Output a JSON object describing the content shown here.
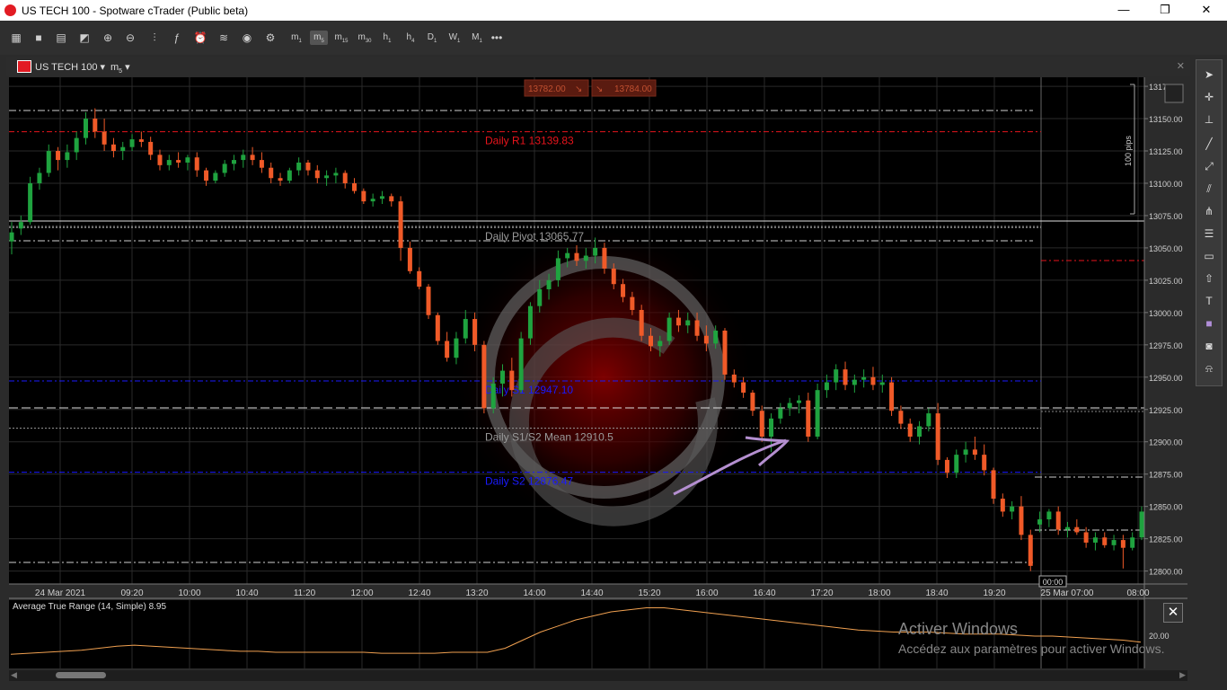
{
  "window": {
    "title": "US TECH 100 - Spotware cTrader (Public beta)",
    "minimize": "—",
    "restore": "❐",
    "close": "✕"
  },
  "toolbar": {
    "timeframes": [
      {
        "label": "m",
        "sub": "1",
        "selected": false
      },
      {
        "label": "m",
        "sub": "5",
        "selected": true
      },
      {
        "label": "m",
        "sub": "15",
        "selected": false
      },
      {
        "label": "m",
        "sub": "30",
        "selected": false
      },
      {
        "label": "h",
        "sub": "1",
        "selected": false
      },
      {
        "label": "h",
        "sub": "4",
        "selected": false
      },
      {
        "label": "D",
        "sub": "1",
        "selected": false
      },
      {
        "label": "W",
        "sub": "1",
        "selected": false
      },
      {
        "label": "M",
        "sub": "1",
        "selected": false
      }
    ],
    "more": "•••"
  },
  "chart_tab": {
    "symbol": "US TECH 100",
    "timeframe": "m",
    "timeframe_sub": "5"
  },
  "price_badges": {
    "sell": "13782.00",
    "buy": "13784.00"
  },
  "chart_data": {
    "type": "candlestick",
    "symbol": "US TECH 100",
    "timeframe": "m5",
    "y_ticks": [
      "13175.00",
      "13150.00",
      "13125.00",
      "13100.00",
      "13075.00",
      "13050.00",
      "13025.00",
      "13000.00",
      "12975.00",
      "12950.00",
      "12925.00",
      "12900.00",
      "12875.00",
      "12850.00",
      "12825.00",
      "12800.00"
    ],
    "x_ticks": [
      "24 Mar 2021",
      "09:20",
      "10:00",
      "10:40",
      "11:20",
      "12:00",
      "12:40",
      "13:20",
      "14:00",
      "14:40",
      "15:20",
      "16:00",
      "16:40",
      "17:20",
      "18:00",
      "18:40",
      "19:20",
      "25 Mar 07:00",
      "08:00"
    ],
    "pips_label": "100 pips",
    "time_marker": "00:00",
    "levels": [
      {
        "label": "Daily R1 13139.83",
        "value": 13139.83,
        "color": "#e8141c"
      },
      {
        "label": "Daily Pivot 13065.77",
        "value": 13065.77,
        "color": "#9a9a9a"
      },
      {
        "label": "Daily S1 12947.10",
        "value": 12947.1,
        "color": "#1a1aff"
      },
      {
        "label": "Daily S1/S2 Mean 12910.5",
        "value": 12910.5,
        "color": "#9a9a9a"
      },
      {
        "label": "Daily S2 12876.47",
        "value": 12876.47,
        "color": "#1a1aff"
      }
    ],
    "candles": [
      {
        "o": 13055,
        "h": 13070,
        "l": 13045,
        "c": 13062
      },
      {
        "o": 13065,
        "h": 13075,
        "l": 13060,
        "c": 13070
      },
      {
        "o": 13070,
        "h": 13105,
        "l": 13068,
        "c": 13100
      },
      {
        "o": 13100,
        "h": 13112,
        "l": 13095,
        "c": 13108
      },
      {
        "o": 13108,
        "h": 13130,
        "l": 13105,
        "c": 13125
      },
      {
        "o": 13125,
        "h": 13128,
        "l": 13110,
        "c": 13118
      },
      {
        "o": 13118,
        "h": 13130,
        "l": 13112,
        "c": 13124
      },
      {
        "o": 13124,
        "h": 13140,
        "l": 13118,
        "c": 13135
      },
      {
        "o": 13135,
        "h": 13155,
        "l": 13130,
        "c": 13150
      },
      {
        "o": 13150,
        "h": 13158,
        "l": 13135,
        "c": 13140
      },
      {
        "o": 13140,
        "h": 13150,
        "l": 13125,
        "c": 13130
      },
      {
        "o": 13130,
        "h": 13135,
        "l": 13120,
        "c": 13125
      },
      {
        "o": 13125,
        "h": 13132,
        "l": 13118,
        "c": 13128
      },
      {
        "o": 13128,
        "h": 13138,
        "l": 13125,
        "c": 13134
      },
      {
        "o": 13134,
        "h": 13140,
        "l": 13128,
        "c": 13132
      },
      {
        "o": 13132,
        "h": 13136,
        "l": 13118,
        "c": 13122
      },
      {
        "o": 13122,
        "h": 13126,
        "l": 13110,
        "c": 13114
      },
      {
        "o": 13114,
        "h": 13122,
        "l": 13110,
        "c": 13118
      },
      {
        "o": 13118,
        "h": 13124,
        "l": 13112,
        "c": 13116
      },
      {
        "o": 13116,
        "h": 13122,
        "l": 13110,
        "c": 13120
      },
      {
        "o": 13120,
        "h": 13124,
        "l": 13105,
        "c": 13110
      },
      {
        "o": 13110,
        "h": 13112,
        "l": 13098,
        "c": 13102
      },
      {
        "o": 13102,
        "h": 13110,
        "l": 13100,
        "c": 13108
      },
      {
        "o": 13108,
        "h": 13118,
        "l": 13105,
        "c": 13115
      },
      {
        "o": 13115,
        "h": 13122,
        "l": 13110,
        "c": 13118
      },
      {
        "o": 13118,
        "h": 13126,
        "l": 13112,
        "c": 13122
      },
      {
        "o": 13122,
        "h": 13128,
        "l": 13114,
        "c": 13118
      },
      {
        "o": 13118,
        "h": 13124,
        "l": 13108,
        "c": 13112
      },
      {
        "o": 13112,
        "h": 13116,
        "l": 13100,
        "c": 13104
      },
      {
        "o": 13104,
        "h": 13108,
        "l": 13098,
        "c": 13102
      },
      {
        "o": 13102,
        "h": 13112,
        "l": 13100,
        "c": 13110
      },
      {
        "o": 13110,
        "h": 13120,
        "l": 13106,
        "c": 13116
      },
      {
        "o": 13116,
        "h": 13118,
        "l": 13106,
        "c": 13110
      },
      {
        "o": 13110,
        "h": 13114,
        "l": 13100,
        "c": 13104
      },
      {
        "o": 13104,
        "h": 13110,
        "l": 13098,
        "c": 13106
      },
      {
        "o": 13106,
        "h": 13112,
        "l": 13100,
        "c": 13108
      },
      {
        "o": 13108,
        "h": 13110,
        "l": 13096,
        "c": 13100
      },
      {
        "o": 13100,
        "h": 13104,
        "l": 13092,
        "c": 13094
      },
      {
        "o": 13094,
        "h": 13096,
        "l": 13084,
        "c": 13086
      },
      {
        "o": 13086,
        "h": 13092,
        "l": 13082,
        "c": 13088
      },
      {
        "o": 13088,
        "h": 13094,
        "l": 13084,
        "c": 13090
      },
      {
        "o": 13090,
        "h": 13092,
        "l": 13082,
        "c": 13086
      },
      {
        "o": 13086,
        "h": 13090,
        "l": 13040,
        "c": 13050
      },
      {
        "o": 13050,
        "h": 13055,
        "l": 13030,
        "c": 13032
      },
      {
        "o": 13032,
        "h": 13035,
        "l": 13018,
        "c": 13020
      },
      {
        "o": 13020,
        "h": 13022,
        "l": 12995,
        "c": 12998
      },
      {
        "o": 12998,
        "h": 13000,
        "l": 12975,
        "c": 12978
      },
      {
        "o": 12978,
        "h": 12985,
        "l": 12962,
        "c": 12965
      },
      {
        "o": 12965,
        "h": 12985,
        "l": 12960,
        "c": 12980
      },
      {
        "o": 12980,
        "h": 13002,
        "l": 12976,
        "c": 12995
      },
      {
        "o": 12995,
        "h": 13000,
        "l": 12970,
        "c": 12975
      },
      {
        "o": 12975,
        "h": 12978,
        "l": 12922,
        "c": 12926
      },
      {
        "o": 12926,
        "h": 12950,
        "l": 12922,
        "c": 12945
      },
      {
        "o": 12945,
        "h": 12960,
        "l": 12935,
        "c": 12955
      },
      {
        "o": 12955,
        "h": 12965,
        "l": 12935,
        "c": 12940
      },
      {
        "o": 12940,
        "h": 12985,
        "l": 12938,
        "c": 12980
      },
      {
        "o": 12980,
        "h": 13008,
        "l": 12975,
        "c": 13005
      },
      {
        "o": 13005,
        "h": 13025,
        "l": 13000,
        "c": 13018
      },
      {
        "o": 13018,
        "h": 13030,
        "l": 13010,
        "c": 13025
      },
      {
        "o": 13025,
        "h": 13048,
        "l": 13020,
        "c": 13042
      },
      {
        "o": 13042,
        "h": 13050,
        "l": 13035,
        "c": 13046
      },
      {
        "o": 13046,
        "h": 13052,
        "l": 13036,
        "c": 13040
      },
      {
        "o": 13040,
        "h": 13050,
        "l": 13034,
        "c": 13044
      },
      {
        "o": 13044,
        "h": 13058,
        "l": 13038,
        "c": 13050
      },
      {
        "o": 13050,
        "h": 13054,
        "l": 13030,
        "c": 13034
      },
      {
        "o": 13034,
        "h": 13038,
        "l": 13018,
        "c": 13022
      },
      {
        "o": 13022,
        "h": 13026,
        "l": 13008,
        "c": 13012
      },
      {
        "o": 13012,
        "h": 13016,
        "l": 12998,
        "c": 13002
      },
      {
        "o": 13002,
        "h": 13006,
        "l": 12978,
        "c": 12982
      },
      {
        "o": 12982,
        "h": 12988,
        "l": 12970,
        "c": 12974
      },
      {
        "o": 12974,
        "h": 12982,
        "l": 12966,
        "c": 12978
      },
      {
        "o": 12978,
        "h": 13000,
        "l": 12975,
        "c": 12996
      },
      {
        "o": 12996,
        "h": 13002,
        "l": 12985,
        "c": 12990
      },
      {
        "o": 12990,
        "h": 13000,
        "l": 12984,
        "c": 12994
      },
      {
        "o": 12994,
        "h": 13000,
        "l": 12978,
        "c": 12982
      },
      {
        "o": 12982,
        "h": 12990,
        "l": 12970,
        "c": 12976
      },
      {
        "o": 12976,
        "h": 12990,
        "l": 12972,
        "c": 12986
      },
      {
        "o": 12986,
        "h": 12988,
        "l": 12948,
        "c": 12952
      },
      {
        "o": 12952,
        "h": 12956,
        "l": 12942,
        "c": 12946
      },
      {
        "o": 12946,
        "h": 12950,
        "l": 12934,
        "c": 12938
      },
      {
        "o": 12938,
        "h": 12940,
        "l": 12920,
        "c": 12924
      },
      {
        "o": 12924,
        "h": 12928,
        "l": 12900,
        "c": 12904
      },
      {
        "o": 12904,
        "h": 12922,
        "l": 12892,
        "c": 12918
      },
      {
        "o": 12918,
        "h": 12930,
        "l": 12914,
        "c": 12926
      },
      {
        "o": 12926,
        "h": 12934,
        "l": 12920,
        "c": 12930
      },
      {
        "o": 12930,
        "h": 12936,
        "l": 12922,
        "c": 12932
      },
      {
        "o": 12932,
        "h": 12938,
        "l": 12900,
        "c": 12904
      },
      {
        "o": 12904,
        "h": 12945,
        "l": 12902,
        "c": 12940
      },
      {
        "o": 12940,
        "h": 12952,
        "l": 12934,
        "c": 12946
      },
      {
        "o": 12946,
        "h": 12960,
        "l": 12940,
        "c": 12956
      },
      {
        "o": 12956,
        "h": 12962,
        "l": 12940,
        "c": 12944
      },
      {
        "o": 12944,
        "h": 12952,
        "l": 12938,
        "c": 12948
      },
      {
        "o": 12948,
        "h": 12956,
        "l": 12942,
        "c": 12950
      },
      {
        "o": 12950,
        "h": 12958,
        "l": 12940,
        "c": 12944
      },
      {
        "o": 12944,
        "h": 12952,
        "l": 12938,
        "c": 12946
      },
      {
        "o": 12946,
        "h": 12950,
        "l": 12920,
        "c": 12924
      },
      {
        "o": 12924,
        "h": 12928,
        "l": 12910,
        "c": 12914
      },
      {
        "o": 12914,
        "h": 12918,
        "l": 12900,
        "c": 12904
      },
      {
        "o": 12904,
        "h": 12916,
        "l": 12898,
        "c": 12912
      },
      {
        "o": 12912,
        "h": 12926,
        "l": 12908,
        "c": 12922
      },
      {
        "o": 12922,
        "h": 12930,
        "l": 12882,
        "c": 12886
      },
      {
        "o": 12886,
        "h": 12888,
        "l": 12872,
        "c": 12876
      },
      {
        "o": 12876,
        "h": 12894,
        "l": 12872,
        "c": 12890
      },
      {
        "o": 12890,
        "h": 12900,
        "l": 12884,
        "c": 12894
      },
      {
        "o": 12894,
        "h": 12904,
        "l": 12886,
        "c": 12890
      },
      {
        "o": 12890,
        "h": 12898,
        "l": 12874,
        "c": 12878
      },
      {
        "o": 12878,
        "h": 12880,
        "l": 12852,
        "c": 12856
      },
      {
        "o": 12856,
        "h": 12860,
        "l": 12842,
        "c": 12846
      },
      {
        "o": 12846,
        "h": 12854,
        "l": 12840,
        "c": 12850
      },
      {
        "o": 12850,
        "h": 12858,
        "l": 12824,
        "c": 12828
      },
      {
        "o": 12828,
        "h": 12832,
        "l": 12800,
        "c": 12804
      },
      {
        "o": 12836,
        "h": 12846,
        "l": 12830,
        "c": 12840
      },
      {
        "o": 12840,
        "h": 12848,
        "l": 12834,
        "c": 12846
      },
      {
        "o": 12846,
        "h": 12850,
        "l": 12828,
        "c": 12832
      },
      {
        "o": 12832,
        "h": 12838,
        "l": 12826,
        "c": 12834
      },
      {
        "o": 12834,
        "h": 12840,
        "l": 12828,
        "c": 12830
      },
      {
        "o": 12830,
        "h": 12834,
        "l": 12818,
        "c": 12822
      },
      {
        "o": 12822,
        "h": 12830,
        "l": 12816,
        "c": 12826
      },
      {
        "o": 12826,
        "h": 12830,
        "l": 12818,
        "c": 12820
      },
      {
        "o": 12820,
        "h": 12828,
        "l": 12816,
        "c": 12824
      },
      {
        "o": 12824,
        "h": 12828,
        "l": 12802,
        "c": 12818
      },
      {
        "o": 12818,
        "h": 12830,
        "l": 12816,
        "c": 12826
      },
      {
        "o": 12826,
        "h": 12850,
        "l": 12824,
        "c": 12846
      }
    ]
  },
  "atr": {
    "label": "Average True Range (14, Simple) 8.95",
    "tick": "20.00",
    "color": "#f0a050",
    "values": [
      7,
      7.5,
      8,
      8.5,
      9,
      10,
      11,
      11.5,
      11,
      10.5,
      10,
      9.5,
      9,
      8.5,
      8.5,
      8,
      8,
      8,
      8,
      8,
      8,
      7.5,
      7.5,
      7.5,
      7.5,
      8,
      8,
      8,
      10,
      14,
      18,
      21,
      24,
      26,
      28,
      29,
      30,
      30,
      29,
      28,
      27,
      26,
      25,
      24,
      23,
      22,
      21,
      20,
      19,
      18.5,
      18,
      18,
      18,
      17.5,
      17,
      17,
      17,
      16.5,
      16,
      16,
      15.5,
      15,
      14.5,
      14,
      13
    ]
  },
  "watermark": {
    "line1": "Activer Windows",
    "line2": "Accédez aux paramètres pour activer Windows."
  },
  "atr_close": "✕"
}
